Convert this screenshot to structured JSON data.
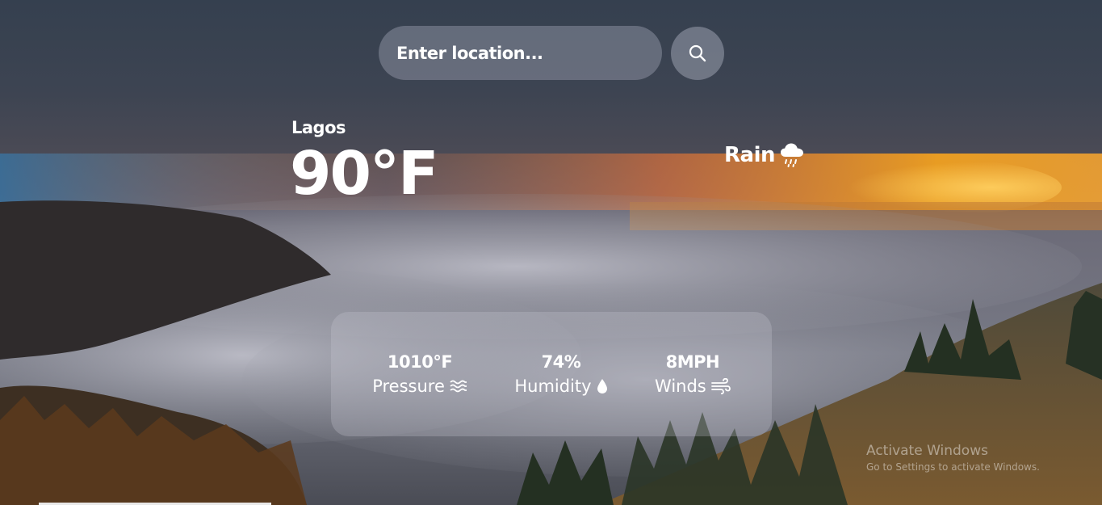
{
  "search": {
    "placeholder": "Enter location..."
  },
  "icons": {
    "search": "search-icon",
    "condition": "cloud-rain-icon",
    "pressure": "water-waves-icon",
    "humidity": "droplet-icon",
    "wind": "wind-icon"
  },
  "weather": {
    "city": "Lagos",
    "temperature": "90°F",
    "condition": "Rain"
  },
  "details": {
    "pressure": {
      "value": "1010°F",
      "label": "Pressure"
    },
    "humidity": {
      "value": "74%",
      "label": "Humidity"
    },
    "wind": {
      "value": "8MPH",
      "label": "Winds"
    }
  },
  "watermark": {
    "title": "Activate Windows",
    "subtitle": "Go to Settings to activate Windows."
  }
}
